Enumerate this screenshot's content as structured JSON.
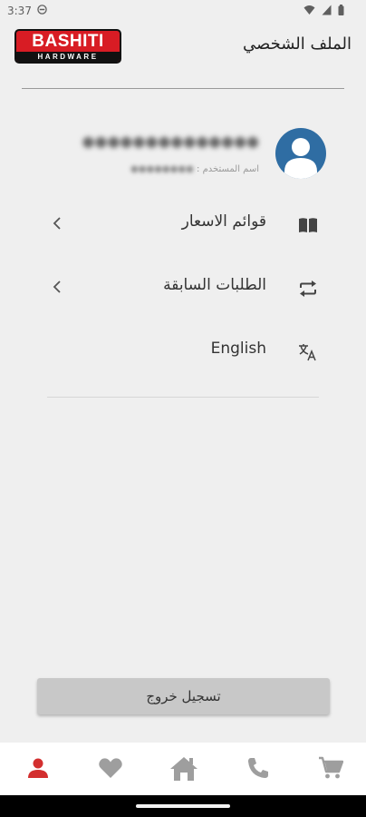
{
  "status_bar": {
    "time": "3:37",
    "icons": [
      "dnd-icon",
      "wifi-icon",
      "signal-icon",
      "battery-icon"
    ]
  },
  "header": {
    "logo_line1": "BASHITI",
    "logo_line2": "HARDWARE",
    "title": "الملف الشخصي"
  },
  "profile": {
    "name": "●●●●●●●●●●●●●●",
    "username_label": "اسم المستخدم :",
    "username_value": "●●●●●●●●"
  },
  "menu": {
    "price_lists": {
      "label": "قوائم الاسعار",
      "icon": "book-icon"
    },
    "previous_orders": {
      "label": "الطلبات السابقة",
      "icon": "repeat-icon"
    },
    "language": {
      "label": "English",
      "icon": "translate-icon"
    }
  },
  "logout": {
    "label": "تسجيل خروج"
  },
  "bottom_nav": {
    "items": [
      "profile-icon",
      "favorites-icon",
      "home-icon",
      "phone-icon",
      "cart-icon"
    ],
    "active": "profile-icon"
  },
  "colors": {
    "brand_red": "#d81c24",
    "avatar_blue": "#2f6da3",
    "background": "#efefef",
    "active_nav": "#d32f2f",
    "inactive_nav": "#9e9e9e"
  }
}
